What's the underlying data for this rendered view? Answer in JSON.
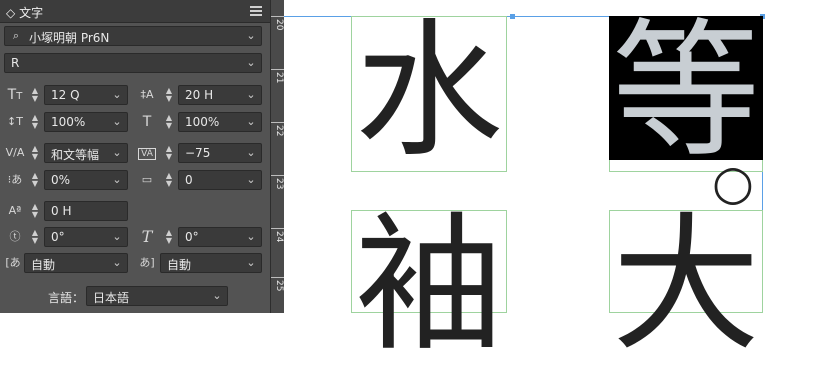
{
  "panel": {
    "title": "文字",
    "font_family": "小塚明朝 Pr6N",
    "font_style": "R",
    "font_size": "12 Q",
    "leading": "20 H",
    "vertical_scale": "100%",
    "horizontal_scale": "100%",
    "kerning": "和文等幅",
    "tracking": "−75",
    "tsume": "0%",
    "grid_count": "0",
    "baseline_shift": "0 H",
    "char_rotation": "0°",
    "skew": "0°",
    "aki_before": "自動",
    "aki_after": "自動",
    "language_label": "言語：",
    "language": "日本語"
  },
  "ruler": {
    "labels": [
      "20",
      "21",
      "22",
      "23",
      "24",
      "25"
    ]
  },
  "canvas": {
    "glyphs": [
      "水",
      "等",
      "袖",
      "大"
    ],
    "circle": "○"
  }
}
